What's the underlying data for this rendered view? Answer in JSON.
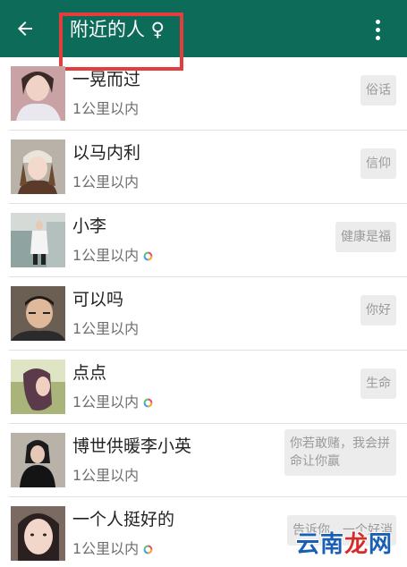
{
  "header": {
    "title": "附近的人 ♀",
    "back_icon": "arrow-left-icon",
    "menu_icon": "more-vertical-icon",
    "background": "#0d6b5a",
    "highlight_color": "#e33d3d"
  },
  "people": [
    {
      "name": "一晃而过",
      "distance": "1公里以内",
      "signature": "俗话",
      "vip": false
    },
    {
      "name": "以马内利",
      "distance": "1公里以内",
      "signature": "信仰",
      "vip": false
    },
    {
      "name": "小李",
      "distance": "1公里以内",
      "signature": "健康是福",
      "vip": true
    },
    {
      "name": "可以吗",
      "distance": "1公里以内",
      "signature": "你好",
      "vip": false
    },
    {
      "name": "点点",
      "distance": "1公里以内",
      "signature": "生命",
      "vip": true
    },
    {
      "name": "博世供暖李小英",
      "distance": "1公里以内",
      "signature": "你若敢赌，我会拼命让你赢",
      "vip": false
    },
    {
      "name": "一个人挺好的",
      "distance": "1公里以内",
      "signature": "告诉你，一个好消",
      "vip": true
    }
  ],
  "watermark": {
    "part1": "云南",
    "part2": "龙",
    "part3": "网"
  }
}
